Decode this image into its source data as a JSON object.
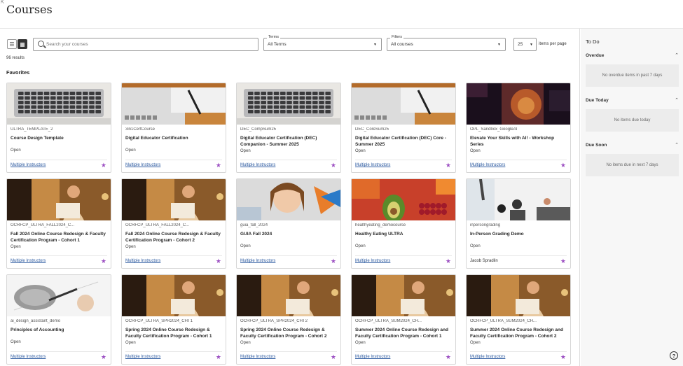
{
  "page_title": "Courses",
  "search": {
    "placeholder": "Search your courses"
  },
  "terms": {
    "label": "Terms",
    "value": "All Terms"
  },
  "filters": {
    "label": "Filters",
    "value": "All courses"
  },
  "items_per_page": {
    "value": "25",
    "label": "items per page"
  },
  "results_count": "96 results",
  "favorites_heading": "Favorites",
  "colors": {
    "accent_star": "#9c4fc2",
    "link": "#2c5aa0"
  },
  "courses": [
    {
      "code": "ULTRA_TEMPLATE_2",
      "name": "Course Design Template",
      "status": "Open",
      "instructor": "Multiple Instructors",
      "thumb": "laptop"
    },
    {
      "code": "3in1CertCourse",
      "name": "Digital Educator Certification",
      "status": "Open",
      "instructor": "Multiple Instructors",
      "thumb": "laptop-desk"
    },
    {
      "code": "DEC_CompSum25",
      "name": "Digital Educator Certification (DEC) Companion - Summer 2025",
      "status": "Open",
      "instructor": "Multiple Instructors",
      "thumb": "laptop"
    },
    {
      "code": "DEC_CoreSum25",
      "name": "Digital Educator Certification (DEC) Core - Summer 2025",
      "status": "Open",
      "instructor": "Multiple Instructors",
      "thumb": "laptop-desk"
    },
    {
      "code": "OPL_Sandbox_GoogleAI",
      "name": "Elevate Your Skills with AI! - Workshop Series",
      "status": "Open",
      "instructor": "Multiple Instructors",
      "thumb": "lion"
    },
    {
      "code": "OCRFCP_ULTRA_FALL2024_C...",
      "name": "Fall 2024 Online Course Redesign & Faculty Certification Program - Cohort 1",
      "status": "Open",
      "instructor": "Multiple Instructors",
      "thumb": "woman-laptop"
    },
    {
      "code": "OCRFCP_ULTRA_FALL2024_C...",
      "name": "Fall 2024 Online Course Redesign & Faculty Certification Program - Cohort 2",
      "status": "Open",
      "instructor": "Multiple Instructors",
      "thumb": "woman-laptop"
    },
    {
      "code": "guia_fall_2024",
      "name": "GUIA Fall 2024",
      "status": "Open",
      "instructor": "Multiple Instructors",
      "thumb": "portrait"
    },
    {
      "code": "healthyeating_democourse",
      "name": "Healthy Eating ULTRA",
      "status": "Open",
      "instructor": "Multiple Instructors",
      "thumb": "food"
    },
    {
      "code": "inpersongrading",
      "name": "In-Person Grading Demo",
      "status": "Open",
      "instructor": "Jacob Spradlin",
      "thumb": "classroom"
    },
    {
      "code": "ai_design_assistant_demo",
      "name": "Principles of Accounting",
      "status": "Open",
      "instructor": "Multiple Instructors",
      "thumb": "writing"
    },
    {
      "code": "OCRFCP_ULTRA_SPR2024_CHT1",
      "name": "Spring 2024 Online Course Redesign & Faculty Certification Program - Cohort 1",
      "status": "Open",
      "instructor": "Multiple Instructors",
      "thumb": "woman-laptop"
    },
    {
      "code": "OCRFCP_ULTRA_SPR2024_CHT2",
      "name": "Spring 2024 Online Course Redesign & Faculty Certification Program - Cohort 2",
      "status": "Open",
      "instructor": "Multiple Instructors",
      "thumb": "woman-laptop"
    },
    {
      "code": "OCRFCP_ULTRA_SUM2024_CH...",
      "name": "Summer 2024 Online Course Redesign and Faculty Certification Program - Cohort 1",
      "status": "Open",
      "instructor": "Multiple Instructors",
      "thumb": "woman-laptop"
    },
    {
      "code": "OCRFCP_ULTRA_SUM2024_CH...",
      "name": "Summer 2024 Online Course Redesign and Faculty Certification Program - Cohort 2",
      "status": "Open",
      "instructor": "Multiple Instructors",
      "thumb": "woman-laptop"
    }
  ],
  "todo": {
    "title": "To Do",
    "sections": [
      {
        "label": "Overdue",
        "message": "No overdue items in past 7 days"
      },
      {
        "label": "Due Today",
        "message": "No items due today"
      },
      {
        "label": "Due Soon",
        "message": "No items due in next 7 days"
      }
    ]
  },
  "help_icon": "?"
}
